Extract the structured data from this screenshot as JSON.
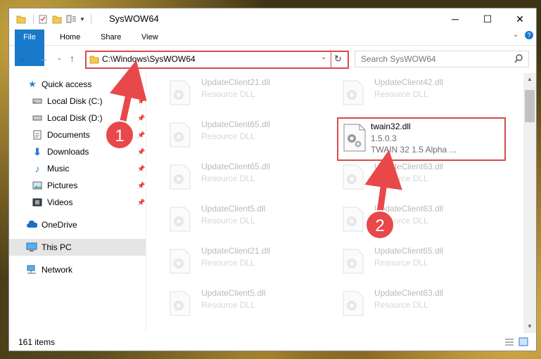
{
  "window": {
    "title": "SysWOW64"
  },
  "ribbon": {
    "tabs": [
      "File",
      "Home",
      "Share",
      "View"
    ]
  },
  "address": {
    "path": "C:\\Windows\\SysWOW64"
  },
  "search": {
    "placeholder": "Search SysWOW64"
  },
  "sidebar": {
    "items": [
      {
        "label": "Quick access",
        "icon": "star-icon"
      },
      {
        "label": "Local Disk (C:)",
        "icon": "drive-icon"
      },
      {
        "label": "Local Disk (D:)",
        "icon": "drive-icon"
      },
      {
        "label": "Documents",
        "icon": "documents-icon"
      },
      {
        "label": "Downloads",
        "icon": "download-icon"
      },
      {
        "label": "Music",
        "icon": "music-icon"
      },
      {
        "label": "Pictures",
        "icon": "pictures-icon"
      },
      {
        "label": "Videos",
        "icon": "videos-icon"
      },
      {
        "label": "OneDrive",
        "icon": "cloud-icon"
      },
      {
        "label": "This PC",
        "icon": "computer-icon"
      },
      {
        "label": "Network",
        "icon": "network-icon"
      }
    ]
  },
  "files": [
    {
      "name": "UpdateClient21.dll",
      "type": "Resource DLL"
    },
    {
      "name": "UpdateClient42.dll",
      "type": "Resource DLL"
    },
    {
      "name": "UpdateClient65.dll",
      "type": "Resource DLL"
    },
    {
      "name": "twain32.dll",
      "type": "1.5.0.3",
      "desc": "TWAIN 32 1.5 Alpha ..."
    },
    {
      "name": "UpdateClient65.dll",
      "type": "Resource DLL"
    },
    {
      "name": "UpdateClient63.dll",
      "type": "Resource DLL"
    },
    {
      "name": "UpdateClient5.dll",
      "type": "Resource DLL"
    },
    {
      "name": "UpdateClient63.dll",
      "type": "Resource DLL"
    },
    {
      "name": "UpdateClient21.dll",
      "type": "Resource DLL"
    },
    {
      "name": "UpdateClient65.dll",
      "type": "Resource DLL"
    },
    {
      "name": "UpdateClient5.dll",
      "type": "Resource DLL"
    },
    {
      "name": "UpdateClient63.dll",
      "type": "Resource DLL"
    }
  ],
  "status": {
    "items": "161 items"
  },
  "annotations": {
    "step1": "1",
    "step2": "2"
  },
  "colors": {
    "accent": "#1979ca",
    "highlight": "#d84a4a"
  }
}
